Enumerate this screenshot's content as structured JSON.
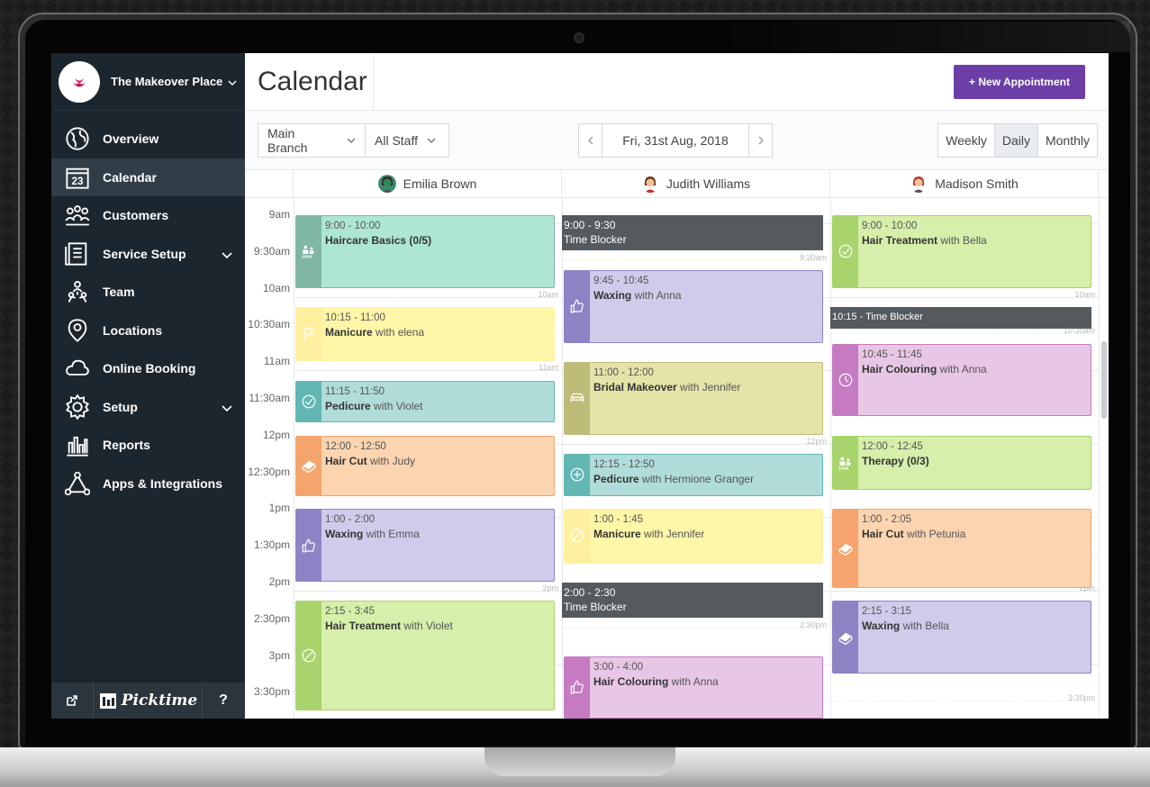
{
  "brand": {
    "name": "The Makeover Place"
  },
  "page": {
    "title": "Calendar",
    "new_appointment": "+ New Appointment"
  },
  "sidebar": {
    "items": [
      {
        "label": "Overview",
        "icon": "globe-icon"
      },
      {
        "label": "Calendar",
        "icon": "calendar-icon",
        "active": true
      },
      {
        "label": "Customers",
        "icon": "customers-icon"
      },
      {
        "label": "Service Setup",
        "icon": "list-icon",
        "has_children": true
      },
      {
        "label": "Team",
        "icon": "team-icon"
      },
      {
        "label": "Locations",
        "icon": "location-pin-icon"
      },
      {
        "label": "Online Booking",
        "icon": "cloud-icon"
      },
      {
        "label": "Setup",
        "icon": "gear-icon",
        "has_children": true
      },
      {
        "label": "Reports",
        "icon": "bar-chart-icon"
      },
      {
        "label": "Apps & Integrations",
        "icon": "integrations-icon"
      }
    ],
    "calendar_icon_text": "23",
    "footer": {
      "logo": "Picktime",
      "help": "?"
    }
  },
  "toolbar": {
    "branch": "Main Branch",
    "staff": "All Staff",
    "date": "Fri, 31st Aug, 2018",
    "views": [
      "Weekly",
      "Daily",
      "Monthly"
    ],
    "active_view": "Daily"
  },
  "calendar": {
    "staff": [
      "Emilia Brown",
      "Judith Williams",
      "Madison Smith"
    ],
    "times": [
      "9am",
      "9:30am",
      "10am",
      "10:30am",
      "11am",
      "11:30am",
      "12pm",
      "12:30pm",
      "1pm",
      "1:30pm",
      "2pm",
      "2:30pm",
      "3pm",
      "3:30pm"
    ],
    "gutter_marks": {
      "col0": [
        "10am",
        "11am",
        "2pm"
      ],
      "col1": [
        "9:30am",
        "12pm",
        "2:30pm"
      ],
      "col2": [
        "10am",
        "10:30am",
        "2pm",
        "3:30pm"
      ]
    },
    "appointments": [
      {
        "col": 0,
        "time": "9:00 - 10:00",
        "service": "Haircare Basics (0/5)",
        "with": "",
        "color": "#aee6d6",
        "strip": "#7fb6a6",
        "icon": "group-icon"
      },
      {
        "col": 0,
        "time": "10:15 - 11:00",
        "service": "Manicure",
        "with": " with elena",
        "color": "#fff6a8",
        "strip": "#fff0a0",
        "icon": "flag-icon"
      },
      {
        "col": 0,
        "time": "11:15 - 11:50",
        "service": "Pedicure",
        "with": " with Violet",
        "color": "#b0dcd9",
        "strip": "#62b7b3",
        "icon": "check-circle-icon"
      },
      {
        "col": 0,
        "time": "12:00 - 12:50",
        "service": "Hair Cut",
        "with": " with Judy",
        "color": "#fcd4b0",
        "strip": "#f4a46c",
        "icon": "eraser-icon"
      },
      {
        "col": 0,
        "time": "1:00 - 2:00",
        "service": "Waxing",
        "with": " with Emma",
        "color": "#cfcbeb",
        "strip": "#8e83c4",
        "icon": "thumbs-up-icon"
      },
      {
        "col": 0,
        "time": "2:15 - 3:45",
        "service": "Hair Treatment",
        "with": " with Violet",
        "color": "#d6efaa",
        "strip": "#a7d46c",
        "icon": "ban-icon"
      },
      {
        "col": 1,
        "time": "9:45 - 10:45",
        "service": "Waxing",
        "with": " with Anna",
        "color": "#cfcbeb",
        "strip": "#8e83c4",
        "icon": "thumbs-up-icon"
      },
      {
        "col": 1,
        "time": "11:00 - 12:00",
        "service": "Bridal Makeover",
        "with": " with Jennifer",
        "color": "#e4e3a8",
        "strip": "#bdbc78",
        "icon": "car-icon"
      },
      {
        "col": 1,
        "time": "12:15 - 12:50",
        "service": "Pedicure",
        "with": " with Hermione Granger",
        "color": "#b0dcd9",
        "strip": "#62b7b3",
        "icon": "plus-circle-icon"
      },
      {
        "col": 1,
        "time": "1:00 - 1:45",
        "service": "Manicure",
        "with": " with Jennifer",
        "color": "#fff6a8",
        "strip": "#fff0a0",
        "icon": "ban-icon"
      },
      {
        "col": 1,
        "time": "3:00 - 4:00",
        "service": "Hair Colouring",
        "with": " with Anna",
        "color": "#e8c6e6",
        "strip": "#c57ac1",
        "icon": "thumbs-up-icon"
      },
      {
        "col": 2,
        "time": "9:00 - 10:00",
        "service": "Hair Treatment",
        "with": " with Bella",
        "color": "#d6efaa",
        "strip": "#a7d46c",
        "icon": "check-circle-icon"
      },
      {
        "col": 2,
        "time": "10:45 - 11:45",
        "service": "Hair Colouring",
        "with": " with Anna",
        "color": "#e8c6e6",
        "strip": "#c57ac1",
        "icon": "clock-icon"
      },
      {
        "col": 2,
        "time": "12:00 - 12:45",
        "service": "Therapy (0/3)",
        "with": "",
        "color": "#d6efaa",
        "strip": "#a7d46c",
        "icon": "group-icon"
      },
      {
        "col": 2,
        "time": "1:00 - 2:05",
        "service": "Hair Cut",
        "with": " with Petunia",
        "color": "#fcd4b0",
        "strip": "#f4a46c",
        "icon": "eraser-icon"
      },
      {
        "col": 2,
        "time": "2:15 - 3:15",
        "service": "Waxing",
        "with": " with Bella",
        "color": "#cfcbeb",
        "strip": "#8e83c4",
        "icon": "eraser-icon"
      }
    ],
    "blockers": [
      {
        "col": 1,
        "time": "9:00 - 9:30",
        "label": "Time Blocker"
      },
      {
        "col": 1,
        "time": "2:00 - 2:30",
        "label": "Time Blocker"
      },
      {
        "col": 2,
        "time": "10:15",
        "label": "Time Blocker"
      }
    ]
  }
}
